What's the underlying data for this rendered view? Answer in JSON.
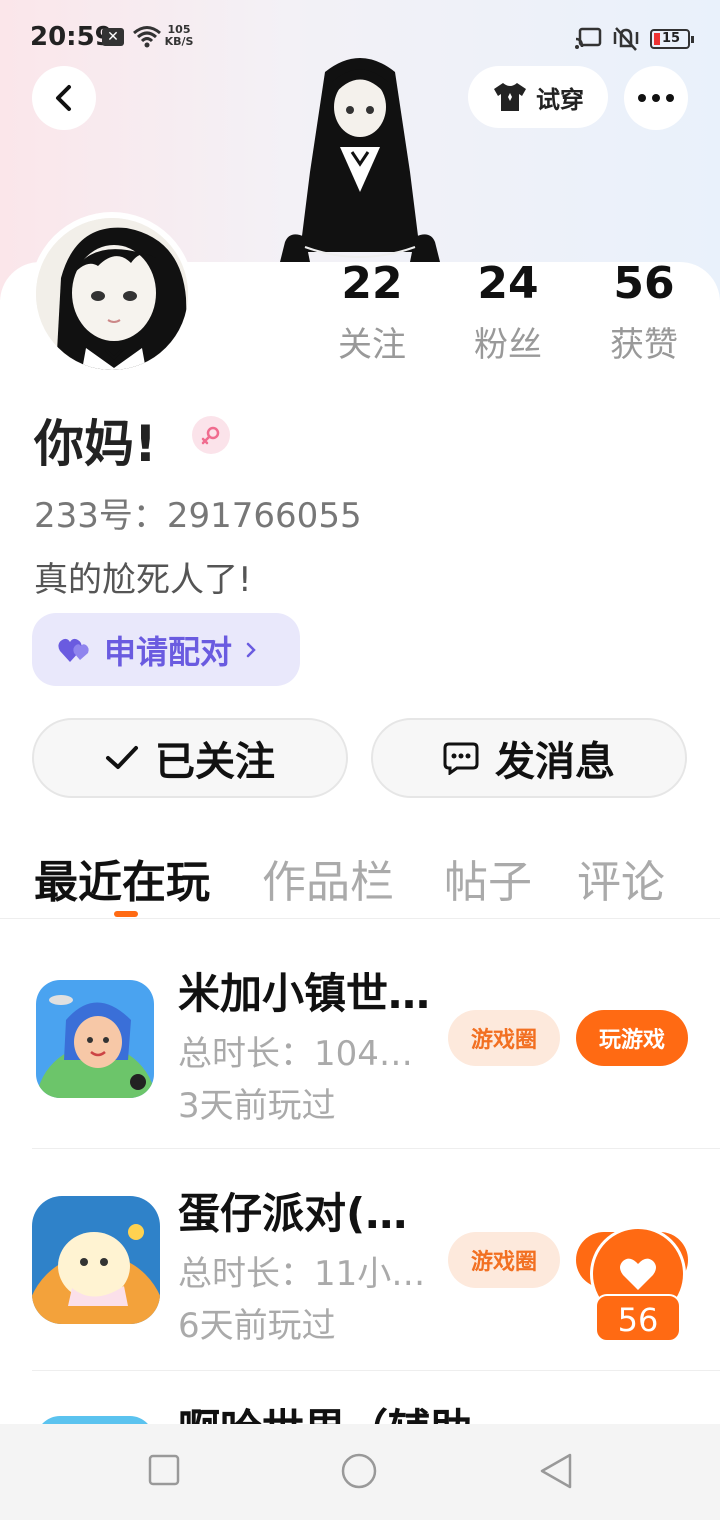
{
  "status_bar": {
    "time": "20:59",
    "notification_badge": "✕",
    "net_speed_value": "105",
    "net_speed_unit": "KB/S",
    "battery_level": "15"
  },
  "header": {
    "tryon_label": "试穿"
  },
  "profile": {
    "following_count": "22",
    "following_label": "关注",
    "fans_count": "24",
    "fans_label": "粉丝",
    "likes_count": "56",
    "likes_label": "获赞",
    "username": "你妈!",
    "gender": "female",
    "user_id": "233号：291766055",
    "bio": "真的尬死人了!",
    "pair_label": "申请配对"
  },
  "actions": {
    "follow_label": "已关注",
    "message_label": "发消息"
  },
  "tabs": [
    {
      "label": "最近在玩",
      "active": true
    },
    {
      "label": "作品栏",
      "active": false
    },
    {
      "label": "帖子",
      "active": false
    },
    {
      "label": "评论",
      "active": false
    }
  ],
  "games": [
    {
      "title": "米加小镇世…",
      "duration": "总时长：104…",
      "last_played": "3天前玩过",
      "circle_label": "游戏圈",
      "play_label": "玩游戏"
    },
    {
      "title": "蛋仔派对(…",
      "duration": "总时长：11小…",
      "last_played": "6天前玩过",
      "circle_label": "游戏圈",
      "play_label": "玩游戏"
    },
    {
      "title": "啊哈世界（辅助"
    }
  ],
  "floating_like": {
    "count": "56"
  },
  "colors": {
    "accent": "#ff6a13",
    "accent_light": "#fde9dc",
    "pair_bg": "#e9e8fb",
    "pair_text": "#6a5be0"
  }
}
